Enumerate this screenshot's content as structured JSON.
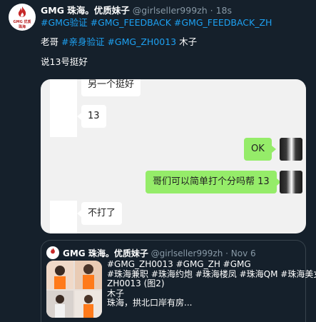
{
  "tweet": {
    "author_name": "GMG 珠海。优质妹子",
    "handle": "@girlseller999zh",
    "separator": "·",
    "time": "18s",
    "hashtags": "#GMG验证 #GMG_FEEDBACK #GMG_FEEDBACK_ZH",
    "line2_prefix": "老哥",
    "line2_tags": "#亲身验证 #GMG_ZH0013",
    "line2_suffix": "木子",
    "line3": "说13号挺好",
    "avatar_text_1": "GMG 优质",
    "avatar_text_2": "珠海"
  },
  "chat": {
    "messages": [
      {
        "side": "left",
        "text": "另一个挺好"
      },
      {
        "side": "left",
        "text": "13"
      },
      {
        "side": "right",
        "text": "OK"
      },
      {
        "side": "right",
        "text": "哥们可以简单打个分吗帮 13"
      },
      {
        "side": "left",
        "text": "不打了"
      }
    ]
  },
  "quote": {
    "author_name": "GMG 珠海。优质妹子",
    "handle": "@girlseller999zh",
    "separator": "·",
    "time": "Nov 6",
    "lines": [
      "#GMG_ZH0013 #GMG_ZH #GMG",
      "#珠海兼职 #珠海约炮  #珠海楼凤 #珠海QM #珠海美女",
      "ZH0013 (图2)",
      "木子",
      "珠海，拱北口岸有房..."
    ]
  },
  "colors": {
    "background": "#15202b",
    "link": "#1da1f2",
    "muted": "#8899a6",
    "wechat_green": "#95ec69",
    "chat_bg": "#f1f1f1",
    "brand_red": "#c62828"
  },
  "icons": {
    "avatar": "gmg-flame-logo",
    "quote_avatar": "gmg-flame-logo"
  }
}
